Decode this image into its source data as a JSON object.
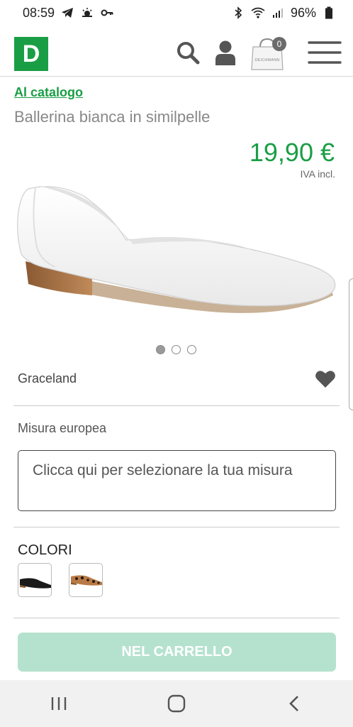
{
  "status_bar": {
    "time": "08:59",
    "battery_percent": "96%",
    "left_icons": [
      "telegram-icon",
      "weather-icon",
      "vpn-key-icon"
    ],
    "right_icons": [
      "bluetooth-icon",
      "wifi-icon",
      "signal-icon",
      "battery-icon"
    ]
  },
  "header": {
    "logo_letter": "D",
    "cart_count": "0",
    "cart_bag_text": "DEICHMANN",
    "brand_color": "#1a9e45"
  },
  "breadcrumb": {
    "back_link": "Al catalogo"
  },
  "product": {
    "title": "Ballerina bianca in similpelle",
    "price": "19,90 €",
    "vat_note": "IVA incl.",
    "brand": "Graceland",
    "image_count": 3,
    "active_image_index": 0
  },
  "size": {
    "label": "Misura europea",
    "placeholder": "Clicca qui per selezionare la tua misura"
  },
  "colors": {
    "label": "COLORI",
    "options": [
      {
        "name": "black-shoe-swatch"
      },
      {
        "name": "leopard-shoe-swatch"
      }
    ]
  },
  "cta": {
    "add_to_cart": "NEL CARRELLO",
    "color": "#b5e2cf"
  },
  "nav": {
    "icons": [
      "recent-apps-icon",
      "home-icon",
      "back-icon"
    ]
  }
}
